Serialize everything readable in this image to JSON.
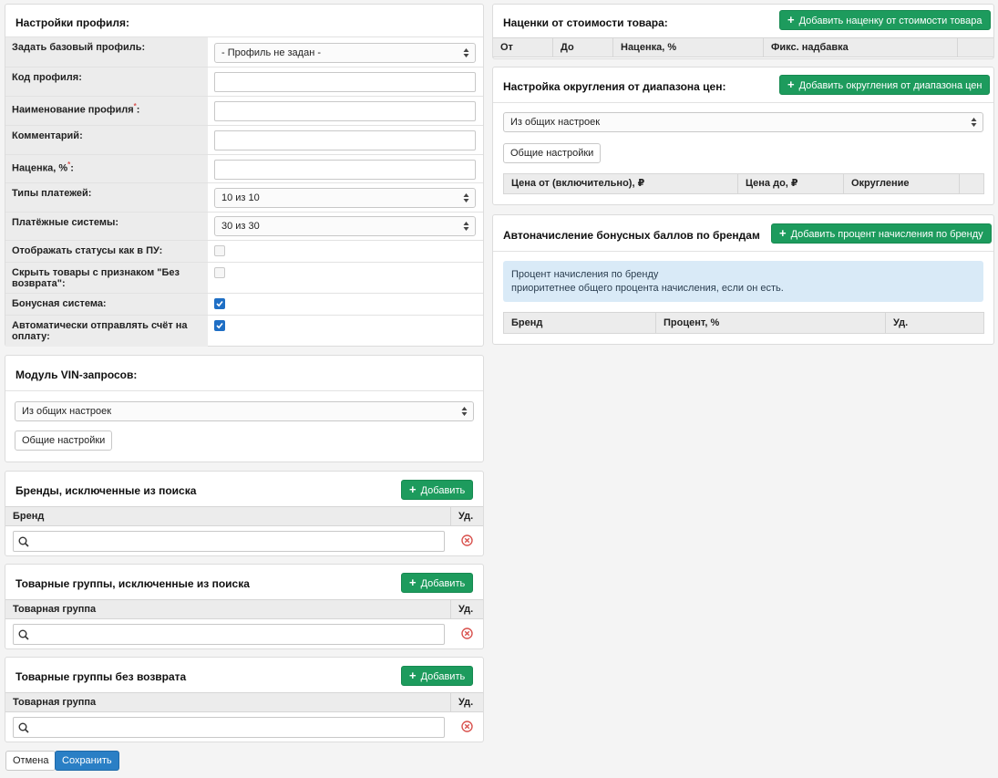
{
  "profile": {
    "title": "Настройки профиля:",
    "rows": {
      "base_profile": {
        "label": "Задать базовый профиль:",
        "value": "- Профиль не задан -"
      },
      "code": {
        "label": "Код профиля:"
      },
      "name": {
        "label": "Наименование профиля",
        "required_mark": "*",
        "suffix": ":"
      },
      "comment": {
        "label": "Комментарий:"
      },
      "markup": {
        "label": "Наценка, %",
        "required_mark": "*",
        "suffix": ":"
      },
      "payment_types": {
        "label": "Типы платежей:",
        "value": "10 из 10"
      },
      "payment_systems": {
        "label": "Платёжные системы:",
        "value": "30 из 30"
      },
      "show_statuses": {
        "label": "Отображать статусы как в ПУ:",
        "checked": false
      },
      "hide_no_return": {
        "label": "Скрыть товары с признаком \"Без возврата\":",
        "checked": false
      },
      "bonus_system": {
        "label": "Бонусная система:",
        "checked": true
      },
      "auto_invoice": {
        "label": "Автоматически отправлять счёт на оплату:",
        "checked": true
      }
    }
  },
  "vin": {
    "title": "Модуль VIN-запросов:",
    "select_value": "Из общих настроек",
    "button": "Общие настройки"
  },
  "excluded_brands": {
    "title": "Бренды, исключенные из поиска",
    "add": "Добавить",
    "col_main": "Бренд",
    "col_del": "Уд."
  },
  "excluded_groups": {
    "title": "Товарные группы, исключенные из поиска",
    "add": "Добавить",
    "col_main": "Товарная группа",
    "col_del": "Уд."
  },
  "no_return_groups": {
    "title": "Товарные группы без возврата",
    "add": "Добавить",
    "col_main": "Товарная группа",
    "col_del": "Уд."
  },
  "footer": {
    "cancel": "Отмена",
    "save": "Сохранить"
  },
  "markups": {
    "title": "Наценки от стоимости товара:",
    "add": "Добавить наценку от стоимости товара",
    "columns": [
      "От",
      "До",
      "Наценка, %",
      "Фикс. надбавка"
    ]
  },
  "rounding": {
    "title": "Настройка округления от диапазона цен:",
    "add": "Добавить округления от диапазона цен",
    "select_value": "Из общих настроек",
    "button": "Общие настройки",
    "columns": [
      "Цена от (включительно), ₽",
      "Цена до, ₽",
      "Округление"
    ]
  },
  "bonus": {
    "title": "Автоначисление бонусных баллов по брендам",
    "add": "Добавить процент начисления по бренду",
    "info_line1": "Процент начисления по бренду",
    "info_line2": "приоритетнее общего процента начисления, если он есть.",
    "columns": [
      "Бренд",
      "Процент, %",
      "Уд."
    ]
  },
  "icons": {
    "plus": "plus-icon",
    "search": "search-icon",
    "delete": "delete-circle-icon",
    "select_arrows": "select-arrows-icon",
    "check": "check-icon"
  },
  "colors": {
    "green": "#1d9b5d",
    "blue": "#2a7fc5",
    "danger": "#d9534f",
    "info_bg": "#d9eaf7"
  }
}
